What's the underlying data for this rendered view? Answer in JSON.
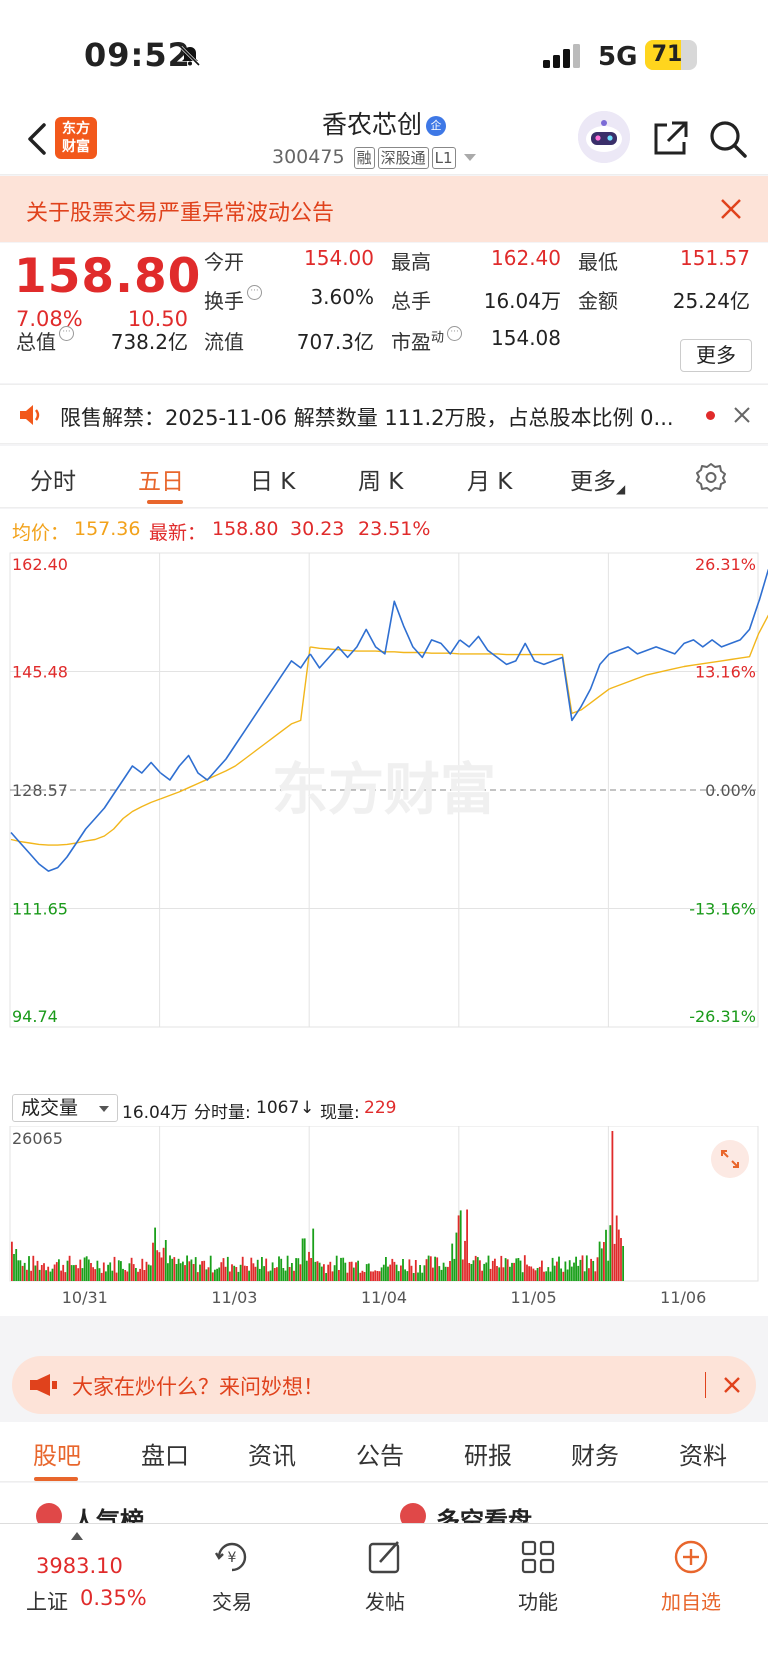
{
  "status_bar": {
    "time": "09:52",
    "network": "5G",
    "battery": "71"
  },
  "header": {
    "stock_name": "香农芯创",
    "badge": "企",
    "code": "300475",
    "tags": [
      "融",
      "深股通",
      "L1"
    ]
  },
  "notice": {
    "text": "关于股票交易严重异常波动公告"
  },
  "quote": {
    "price": "158.80",
    "change_pct": "7.08%",
    "change": "10.50",
    "fields": [
      {
        "label": "今开",
        "value": "154.00"
      },
      {
        "label": "最高",
        "value": "162.40"
      },
      {
        "label": "最低",
        "value": "151.57"
      },
      {
        "label": "换手",
        "value": "3.60%"
      },
      {
        "label": "总手",
        "value": "16.04万"
      },
      {
        "label": "金额",
        "value": "25.24亿"
      },
      {
        "label": "总值",
        "value": "738.2亿"
      },
      {
        "label": "流值",
        "value": "707.3亿"
      },
      {
        "label": "市盈",
        "sup": "动",
        "value": "154.08"
      }
    ],
    "more_label": "更多"
  },
  "unlock": {
    "text": "限售解禁：2025-11-06 解禁数量 111.2万股，占总股本比例 0..."
  },
  "chart_tabs": {
    "items": [
      "分时",
      "五日",
      "日 K",
      "周 K",
      "月 K",
      "更多"
    ],
    "active": "五日"
  },
  "chart_info": {
    "avg_label": "均价：",
    "avg_value": "157.36",
    "latest_label": "最新：",
    "latest_value": "158.80",
    "change": "30.23",
    "change_pct": "23.51%"
  },
  "chart_data": {
    "type": "line",
    "y_labels_left": [
      "162.40",
      "145.48",
      "128.57",
      "111.65",
      "94.74"
    ],
    "y_labels_right": [
      "26.31%",
      "13.16%",
      "0.00%",
      "-13.16%",
      "-26.31%"
    ],
    "ylim": [
      94.74,
      162.4
    ],
    "reference_price": 128.57,
    "x_labels": [
      "10/31",
      "11/03",
      "11/04",
      "11/05",
      "11/06"
    ],
    "series": [
      {
        "values": [
          122.5,
          121.0,
          119.5,
          118.0,
          117.0,
          117.5,
          119.0,
          121.0,
          123.0,
          124.5,
          126.0,
          128.0,
          130.0,
          132.0,
          131.0,
          132.5,
          131.0,
          130.0,
          132.0,
          133.5,
          131.0,
          130.0,
          131.5,
          133.0,
          135.0,
          137.0,
          139.0,
          141.0,
          143.0,
          145.0,
          147.0,
          146.0,
          148.0,
          146.0,
          147.5,
          149.0,
          147.5,
          149.0,
          151.5,
          149.0,
          148.0,
          155.5,
          152.0,
          149.0,
          147.5,
          150.0,
          149.5,
          148.0,
          150.0,
          149.0,
          150.5,
          148.5,
          147.5,
          146.5,
          147.0,
          149.5,
          147.0,
          146.5,
          147.0,
          147.5,
          138.5,
          140.5,
          143.0,
          146.5,
          148.0,
          148.5,
          149.0,
          148.0,
          148.5,
          149.0,
          148.5,
          148.0,
          149.5,
          150.0,
          149.0,
          150.0,
          149.0,
          149.5,
          150.0,
          151.5,
          155.5,
          160.0,
          158.8
        ]
      },
      {
        "values": [
          121.5,
          121.2,
          121.0,
          120.8,
          120.7,
          120.7,
          120.8,
          121.0,
          121.3,
          121.5,
          122.0,
          123.0,
          124.5,
          125.5,
          126.2,
          126.8,
          127.3,
          127.8,
          128.3,
          128.9,
          129.5,
          130.1,
          130.7,
          131.3,
          132.0,
          133.0,
          134.0,
          135.0,
          136.0,
          137.0,
          138.0,
          138.5,
          149.0,
          148.8,
          148.7,
          148.6,
          148.5,
          148.4,
          148.4,
          148.4,
          148.3,
          148.3,
          148.2,
          148.2,
          148.2,
          148.1,
          148.1,
          148.1,
          148.0,
          148.0,
          148.0,
          148.0,
          148.0,
          147.9,
          147.9,
          147.9,
          147.9,
          147.9,
          147.9,
          147.9,
          139.5,
          140.0,
          141.0,
          142.0,
          143.0,
          143.5,
          144.0,
          144.5,
          145.0,
          145.3,
          145.6,
          145.9,
          146.2,
          146.4,
          146.6,
          146.8,
          147.0,
          147.2,
          147.4,
          147.6,
          151.0,
          153.5,
          155.0
        ]
      }
    ]
  },
  "volume": {
    "selector": "成交量",
    "total": "16.04万",
    "bar_label": "分时量:",
    "bar_value": "1067",
    "arrow": "↓",
    "now_label": "现量:",
    "now_value": "229",
    "max_label": "26065"
  },
  "ad": {
    "text": "大家在炒什么？来问妙想！"
  },
  "bottom_tabs": {
    "items": [
      "股吧",
      "盘口",
      "资讯",
      "公告",
      "研报",
      "财务",
      "资料"
    ],
    "active": "股吧"
  },
  "teaser": {
    "left": "人气榜",
    "right": "多空看盘"
  },
  "bottom_nav": {
    "index_value": "3983.10",
    "index_name": "上证",
    "index_pct": "0.35%",
    "items": [
      "交易",
      "发帖",
      "功能",
      "加自选"
    ]
  },
  "colors": {
    "up": "#e02b2b",
    "down": "#1a9a1a",
    "accent": "#e8662c",
    "line": "#2f6fd1",
    "avg": "#f2b61b"
  }
}
